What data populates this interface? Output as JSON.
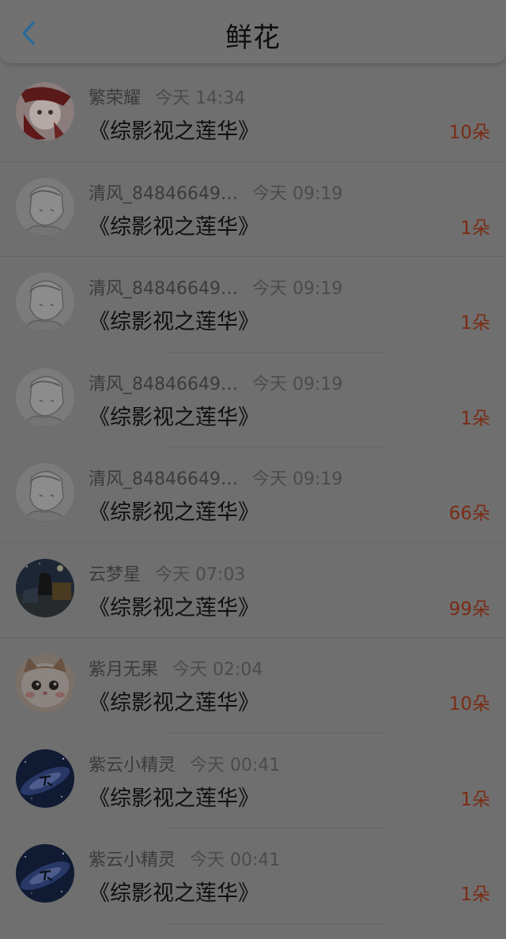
{
  "header": {
    "title": "鲜花",
    "back_icon": "chevron-left-icon",
    "accent_color": "#2a6a9a"
  },
  "items": [
    {
      "name": "繁荣耀",
      "time": "今天 14:34",
      "book": "《综影视之莲华》",
      "count": "10朵",
      "avatar": "anime-girl-red-avatar"
    },
    {
      "name": "清风_84846649…",
      "time": "今天 09:19",
      "book": "《综影视之莲华》",
      "count": "1朵",
      "avatar": "sketch-boy-avatar"
    },
    {
      "name": "清风_84846649…",
      "time": "今天 09:19",
      "book": "《综影视之莲华》",
      "count": "1朵",
      "avatar": "sketch-boy-avatar"
    },
    {
      "name": "清风_84846649…",
      "time": "今天 09:19",
      "book": "《综影视之莲华》",
      "count": "1朵",
      "avatar": "sketch-boy-avatar"
    },
    {
      "name": "清风_84846649…",
      "time": "今天 09:19",
      "book": "《综影视之莲华》",
      "count": "66朵",
      "avatar": "sketch-boy-avatar"
    },
    {
      "name": "云梦星",
      "time": "今天 07:03",
      "book": "《综影视之莲华》",
      "count": "99朵",
      "avatar": "night-scene-avatar"
    },
    {
      "name": "紫月无果",
      "time": "今天 02:04",
      "book": "《综影视之莲华》",
      "count": "10朵",
      "avatar": "cat-avatar"
    },
    {
      "name": "紫云小精灵",
      "time": "今天 00:41",
      "book": "《综影视之莲华》",
      "count": "1朵",
      "avatar": "galaxy-avatar"
    },
    {
      "name": "紫云小精灵",
      "time": "今天 00:41",
      "book": "《综影视之莲华》",
      "count": "1朵",
      "avatar": "galaxy-avatar"
    }
  ],
  "colors": {
    "count_text": "#7a2c14",
    "overlay": "#6f6f6f"
  }
}
